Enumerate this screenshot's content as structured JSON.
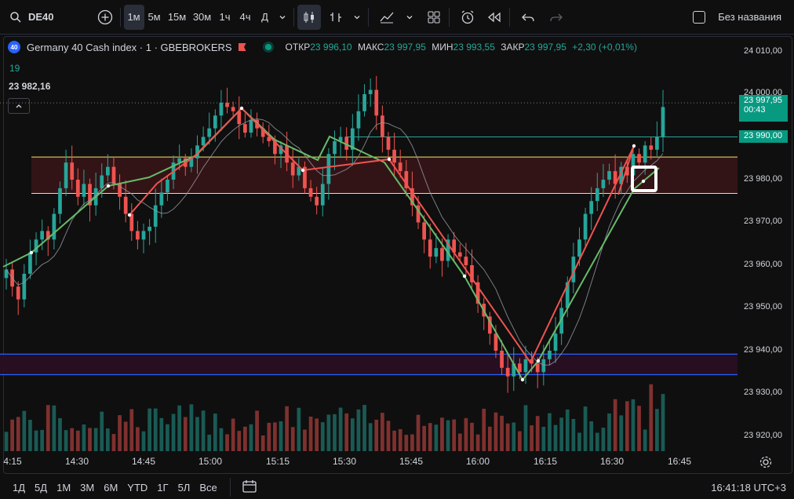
{
  "toolbar": {
    "symbol": "DE40",
    "intervals": [
      "1м",
      "5м",
      "15м",
      "30м",
      "1ч",
      "4ч",
      "Д"
    ],
    "active_interval": "1м",
    "layout_name": "Без названия"
  },
  "legend": {
    "logo_text": "40",
    "instrument": "Germany 40 Cash index · 1 · GBEBROKERS",
    "open_label": "ОТКР",
    "open_value": "23 996,10",
    "high_label": "МАКС",
    "high_value": "23 997,95",
    "low_label": "МИН",
    "low_value": "23 993,55",
    "close_label": "ЗАКР",
    "close_value": "23 997,95",
    "change": "+2,30 (+0,01%)",
    "indicator_value": "19",
    "price_overlay": "23 982,16"
  },
  "price_axis": {
    "ticks": [
      "24 010,00",
      "24 000,00",
      "23 980,00",
      "23 970,00",
      "23 960,00",
      "23 950,00",
      "23 940,00",
      "23 930,00",
      "23 920,00"
    ],
    "current_price": "23 997,95",
    "countdown": "00:43",
    "level_tag": "23 990,00"
  },
  "time_axis": {
    "ticks": [
      "4:15",
      "14:30",
      "14:45",
      "15:00",
      "15:15",
      "15:30",
      "15:45",
      "16:00",
      "16:15",
      "16:30",
      "16:45"
    ]
  },
  "bottom": {
    "ranges": [
      "1Д",
      "5Д",
      "1М",
      "3М",
      "6М",
      "YTD",
      "1Г",
      "5Л",
      "Все"
    ],
    "clock": "16:41:18 UTC+3"
  },
  "colors": {
    "up": "#26a69a",
    "down": "#ef5350",
    "background": "#0f0f0f",
    "resistance_zone": "#3a1518",
    "support_zone": "#2a0e24",
    "yellow_line": "#f5e66b",
    "blue_line": "#2962ff"
  },
  "chart_data": {
    "type": "candlestick",
    "symbol": "DE40",
    "timeframe": "1",
    "ylim": [
      23915,
      24013
    ],
    "ohlc_shape_note": "",
    "closes_approx": [
      23959,
      23955,
      23952,
      23958,
      23963,
      23966,
      23968,
      23966,
      23972,
      23978,
      23984,
      23980,
      23976,
      23979,
      23974,
      23978,
      23981,
      23983,
      23979,
      23976,
      23972,
      23968,
      23966,
      23968,
      23969,
      23974,
      23977,
      23980,
      23984,
      23985,
      23983,
      23985,
      23988,
      23990,
      23992,
      23995,
      23998,
      23997,
      23996,
      23993,
      23991,
      23994,
      23992,
      23990,
      23989,
      23986,
      23988,
      23984,
      23981,
      23983,
      23978,
      23976,
      23974,
      23979,
      23986,
      23989,
      23990,
      23987,
      23992,
      23996,
      24000,
      24001,
      23995,
      23990,
      23987,
      23984,
      23982,
      23978,
      23974,
      23970,
      23966,
      23962,
      23964,
      23961,
      23966,
      23963,
      23962,
      23960,
      23956,
      23951,
      23948,
      23944,
      23940,
      23936,
      23934,
      23937,
      23935,
      23938,
      23937,
      23935,
      23938,
      23940,
      23944,
      23950,
      23956,
      23962,
      23966,
      23972,
      23975,
      23978,
      23980,
      23982,
      23979,
      23983,
      23981,
      23986,
      23984,
      23988,
      23987,
      23990,
      23997
    ],
    "level_lines": [
      23990.0
    ]
  }
}
